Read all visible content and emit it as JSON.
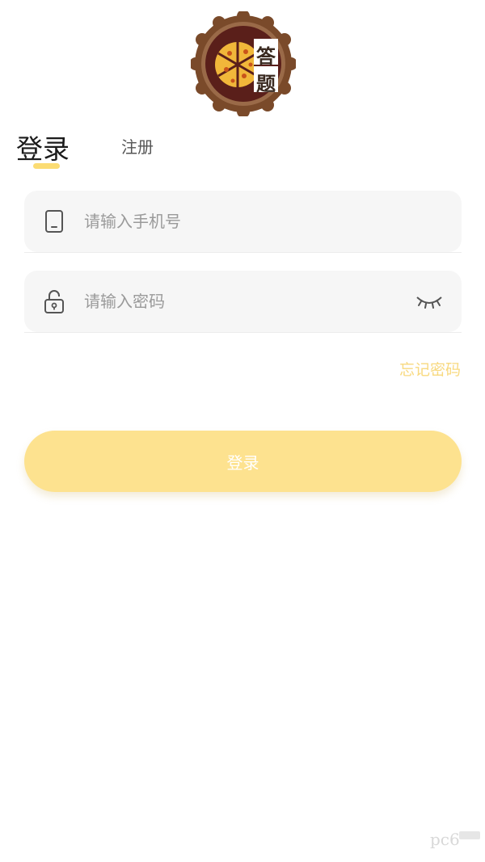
{
  "logo": {
    "text_top": "答",
    "text_bottom": "题",
    "icon": "pizza-badge-icon",
    "colors": {
      "ring": "#7a4a2a",
      "plate": "#5a1f1a",
      "cheese": "#f1b73a",
      "panel": "#ffffff"
    }
  },
  "tabs": [
    {
      "label": "登录",
      "active": true
    },
    {
      "label": "注册",
      "active": false
    }
  ],
  "phone_field": {
    "placeholder": "请输入手机号",
    "value": "",
    "icon": "phone-icon"
  },
  "password_field": {
    "placeholder": "请输入密码",
    "value": "",
    "icon": "lock-icon",
    "toggle_icon": "eye-closed-icon"
  },
  "forgot_password": "忘记密码",
  "login_button": "登录",
  "watermark": "pc6",
  "colors": {
    "accent": "#fbdc73",
    "button": "#fde28f",
    "link": "#f8d97f",
    "field_bg": "#f6f6f6"
  }
}
